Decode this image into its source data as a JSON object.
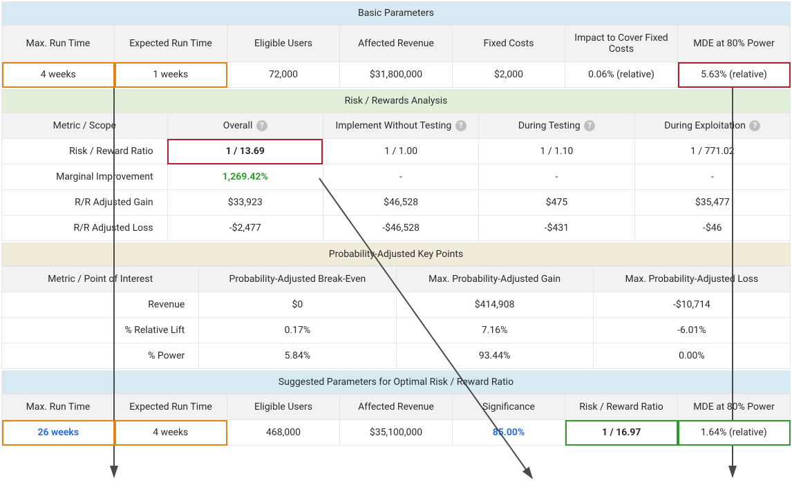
{
  "basic": {
    "title": "Basic Parameters",
    "headers": [
      "Max. Run Time",
      "Expected Run Time",
      "Eligible Users",
      "Affected Revenue",
      "Fixed Costs",
      "Impact to Cover Fixed Costs",
      "MDE at 80% Power"
    ],
    "values": [
      "4 weeks",
      "1 weeks",
      "72,000",
      "$31,800,000",
      "$2,000",
      "0.06% (relative)",
      "5.63% (relative)"
    ]
  },
  "risk": {
    "title": "Risk / Rewards Analysis",
    "col0": "Metric / Scope",
    "cols": [
      "Overall",
      "Implement Without Testing",
      "During Testing",
      "During Exploitation"
    ],
    "rows": [
      {
        "label": "Risk / Reward Ratio",
        "cells": [
          "1 / 13.69",
          "1 / 1.00",
          "1 / 1.10",
          "1 / 771.02"
        ]
      },
      {
        "label": "Marginal Improvement",
        "cells": [
          "1,269.42%",
          "-",
          "-",
          "-"
        ]
      },
      {
        "label": "R/R Adjusted Gain",
        "cells": [
          "$33,923",
          "$46,528",
          "$475",
          "$35,477"
        ]
      },
      {
        "label": "R/R Adjusted Loss",
        "cells": [
          "-$2,477",
          "-$46,528",
          "-$431",
          "-$46"
        ]
      }
    ]
  },
  "prob": {
    "title": "Probability-Adjusted Key Points",
    "col0": "Metric / Point of Interest",
    "cols": [
      "Probability-Adjusted Break-Even",
      "Max. Probability-Adjusted Gain",
      "Max. Probability-Adjusted Loss"
    ],
    "rows": [
      {
        "label": "Revenue",
        "cells": [
          "$0",
          "$414,908",
          "-$10,714"
        ]
      },
      {
        "label": "% Relative Lift",
        "cells": [
          "0.17%",
          "7.16%",
          "-6.01%"
        ]
      },
      {
        "label": "% Power",
        "cells": [
          "5.84%",
          "93.44%",
          "0.00%"
        ]
      }
    ]
  },
  "suggested": {
    "title": "Suggested Parameters for Optimal Risk / Reward Ratio",
    "headers": [
      "Max. Run Time",
      "Expected Run Time",
      "Eligible Users",
      "Affected Revenue",
      "Significance",
      "Risk / Reward Ratio",
      "MDE at 80% Power"
    ],
    "values": [
      "26 weeks",
      "4 weeks",
      "468,000",
      "$35,100,000",
      "85.00%",
      "1 / 16.97",
      "1.64% (relative)"
    ]
  }
}
